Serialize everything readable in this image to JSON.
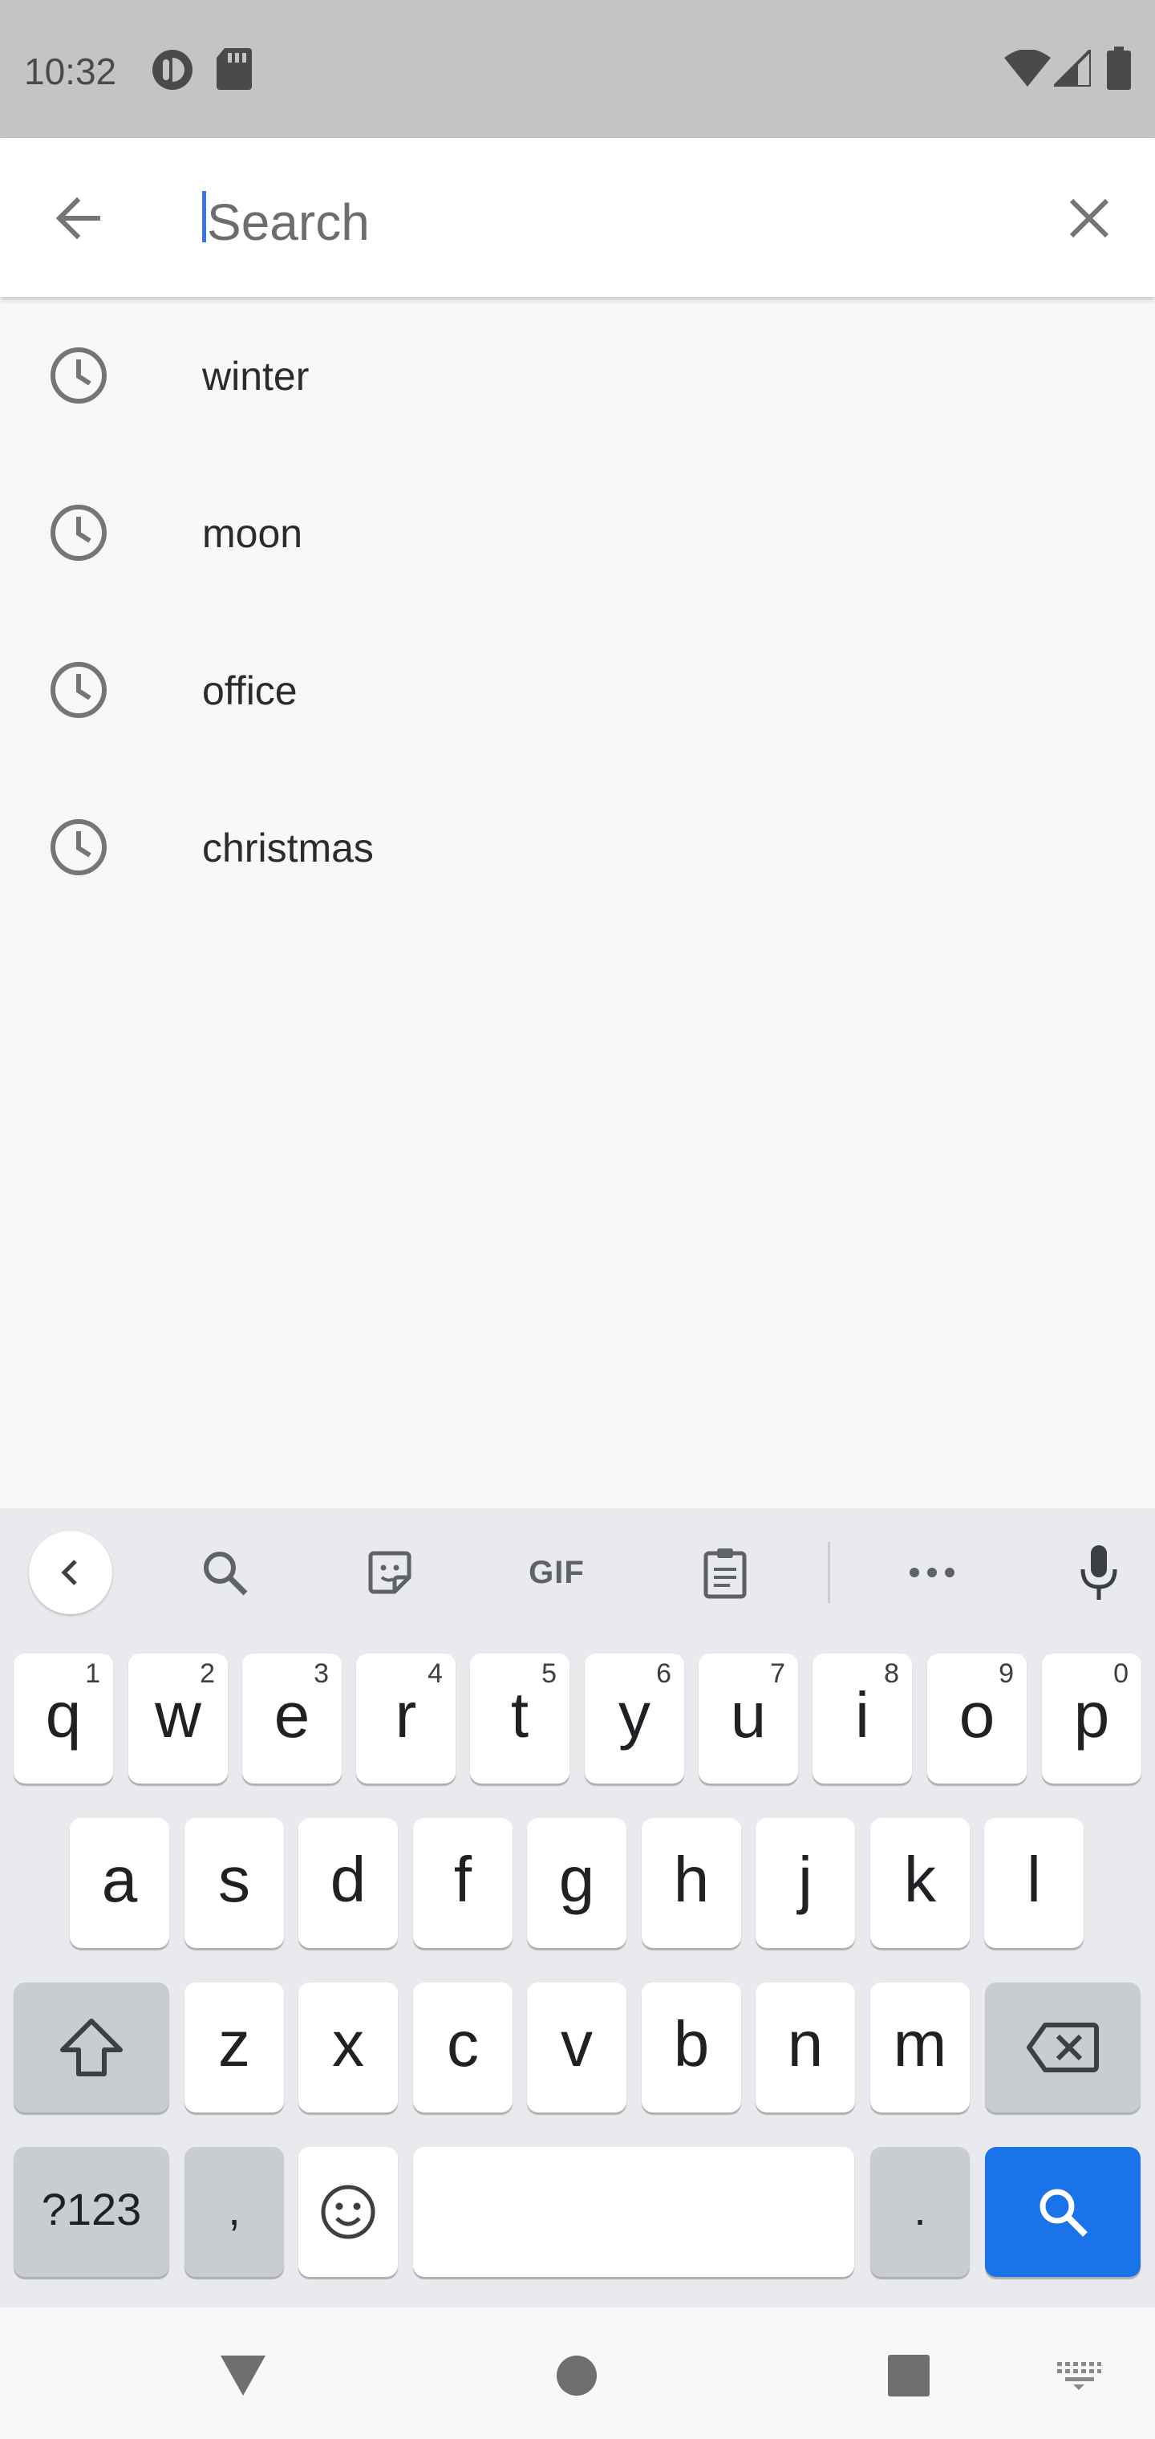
{
  "status_bar": {
    "time": "10:32",
    "icons_left": [
      "notification-app-icon",
      "sd-card-icon"
    ],
    "icons_right": [
      "wifi-icon",
      "cell-signal-icon",
      "battery-icon"
    ]
  },
  "app_bar": {
    "back_icon": "arrow-back-icon",
    "search_placeholder": "Search",
    "search_value": "",
    "clear_icon": "close-icon"
  },
  "history": {
    "icon": "history-clock-icon",
    "items": [
      {
        "label": "winter"
      },
      {
        "label": "moon"
      },
      {
        "label": "office"
      },
      {
        "label": "christmas"
      }
    ]
  },
  "keyboard": {
    "toolbar": {
      "gif_label": "GIF",
      "icons": [
        "chevron-left-icon",
        "search-icon",
        "sticker-icon",
        "gif",
        "clipboard-icon",
        "more-icon",
        "mic-icon"
      ]
    },
    "row1": [
      {
        "key": "q",
        "num": "1"
      },
      {
        "key": "w",
        "num": "2"
      },
      {
        "key": "e",
        "num": "3"
      },
      {
        "key": "r",
        "num": "4"
      },
      {
        "key": "t",
        "num": "5"
      },
      {
        "key": "y",
        "num": "6"
      },
      {
        "key": "u",
        "num": "7"
      },
      {
        "key": "i",
        "num": "8"
      },
      {
        "key": "o",
        "num": "9"
      },
      {
        "key": "p",
        "num": "0"
      }
    ],
    "row2": [
      "a",
      "s",
      "d",
      "f",
      "g",
      "h",
      "j",
      "k",
      "l"
    ],
    "row3": [
      "z",
      "x",
      "c",
      "v",
      "b",
      "n",
      "m"
    ],
    "row4": {
      "symbols": "?123",
      "comma": ",",
      "period": "."
    },
    "accent_color": "#1a73e8"
  },
  "nav_bar": {
    "icons": [
      "back-triangle-icon",
      "home-circle-icon",
      "recents-square-icon",
      "keyboard-switch-icon"
    ]
  }
}
